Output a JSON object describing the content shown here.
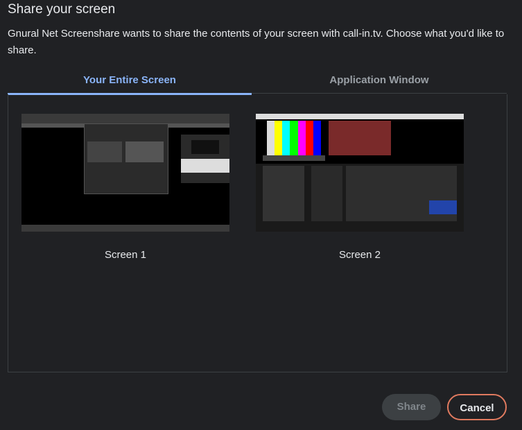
{
  "dialog": {
    "title": "Share your screen",
    "description": "Gnural Net Screenshare wants to share the contents of your screen with call-in.tv. Choose what you'd like to share."
  },
  "tabs": [
    {
      "label": "Your Entire Screen",
      "selected": true
    },
    {
      "label": "Application Window",
      "selected": false
    }
  ],
  "screens": [
    {
      "label": "Screen 1"
    },
    {
      "label": "Screen 2"
    }
  ],
  "buttons": {
    "share_label": "Share",
    "cancel_label": "Cancel",
    "share_enabled": false
  },
  "colors": {
    "accent": "#8ab4f8",
    "background": "#202124",
    "cancel_border": "#e07a5f"
  }
}
